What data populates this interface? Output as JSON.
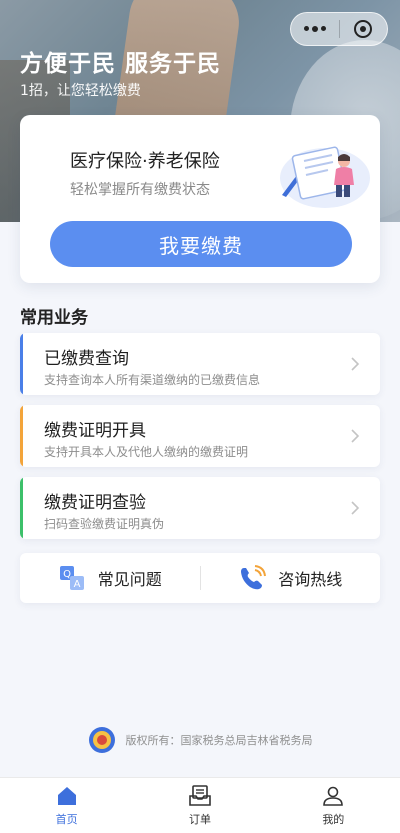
{
  "hero": {
    "title": "方便于民 服务于民",
    "subtitle": "1招，让您轻松缴费"
  },
  "main_card": {
    "title": "医疗保险·养老保险",
    "subtitle": "轻松掌握所有缴费状态",
    "pay_button": "我要缴费"
  },
  "common": {
    "section_title": "常用业务",
    "items": [
      {
        "name": "已缴费查询",
        "desc": "支持查询本人所有渠道缴纳的已缴费信息",
        "color": "#4a7fe8"
      },
      {
        "name": "缴费证明开具",
        "desc": "支持开具本人及代他人缴纳的缴费证明",
        "color": "#f3a43a"
      },
      {
        "name": "缴费证明查验",
        "desc": "扫码查验缴费证明真伪",
        "color": "#3cc06a"
      }
    ]
  },
  "quick": {
    "faq": "常见问题",
    "hotline": "咨询热线"
  },
  "footer": {
    "copyright": "版权所有：国家税务总局吉林省税务局"
  },
  "tabs": {
    "home": "首页",
    "orders": "订单",
    "me": "我的"
  },
  "colors": {
    "accent": "#5b8ef0",
    "active_tab": "#3d6fdc"
  },
  "icons": [
    "more-dots-icon",
    "close-target-icon",
    "qa-icon",
    "phone-icon",
    "tax-emblem-icon",
    "home-icon",
    "order-icon",
    "user-icon",
    "chevron-right-icon"
  ]
}
